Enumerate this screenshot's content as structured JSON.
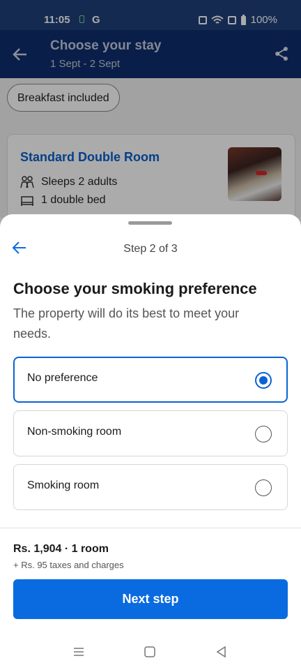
{
  "status_bar": {
    "time": "11:05",
    "carrier_letter": "G",
    "battery_pct": "100%"
  },
  "app_bar": {
    "title": "Choose your stay",
    "dates": "1 Sept - 2 Sept"
  },
  "filter_chip": {
    "label": "Breakfast included"
  },
  "room_card": {
    "name": "Standard Double Room",
    "features": [
      {
        "icon": "people-icon",
        "text": "Sleeps 2 adults"
      },
      {
        "icon": "bed-icon",
        "text": "1 double bed"
      }
    ]
  },
  "sheet": {
    "step_label": "Step 2 of 3",
    "heading": "Choose your smoking preference",
    "description": "The property will do its best to meet your needs.",
    "options": [
      {
        "label": "No preference",
        "selected": true
      },
      {
        "label": "Non-smoking room",
        "selected": false
      },
      {
        "label": "Smoking room",
        "selected": false
      }
    ],
    "price_line": "Rs. 1,904 · 1 room",
    "taxes_line": "+ Rs. 95 taxes and charges",
    "next_button": "Next step"
  },
  "colors": {
    "primary": "#0a6be0",
    "header": "#0e2e6e",
    "selected_border": "#0a63d4"
  },
  "nav_icons": [
    "menu-icon",
    "home-square-icon",
    "back-triangle-icon"
  ]
}
